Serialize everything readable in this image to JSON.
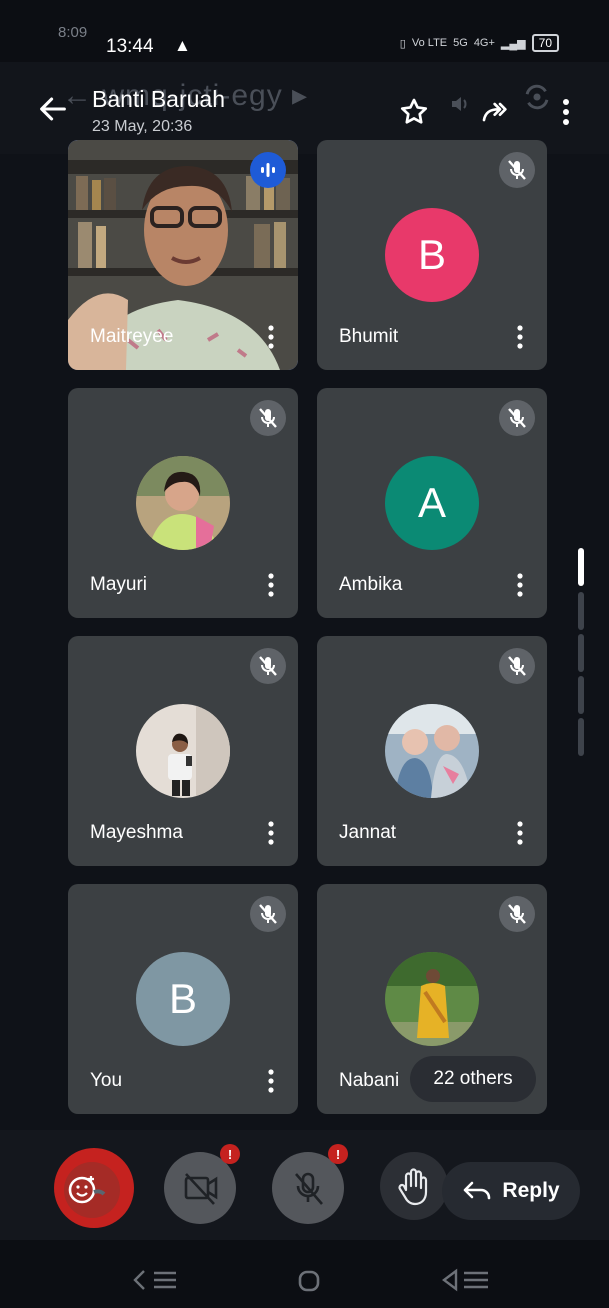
{
  "status_bar": {
    "ghost_time": "8:09",
    "time": "13:44",
    "network_1": "Vo LTE",
    "network_2": "5G",
    "network_3": "4G+",
    "battery": "70"
  },
  "header": {
    "title": "Banti Baruah",
    "subtitle": "23 May, 20:36",
    "ghost_title": "← wmq-jcti-egy ▸"
  },
  "participants": [
    {
      "name": "Maitreyee",
      "type": "video",
      "speaking": true
    },
    {
      "name": "Bhumit",
      "type": "initial",
      "initial": "B",
      "color": "#e8396a"
    },
    {
      "name": "Mayuri",
      "type": "photo"
    },
    {
      "name": "Ambika",
      "type": "initial",
      "initial": "A",
      "color": "#0b8a74"
    },
    {
      "name": "Mayeshma",
      "type": "photo"
    },
    {
      "name": "Jannat",
      "type": "photo"
    },
    {
      "name": "You",
      "type": "initial",
      "initial": "B",
      "color": "#7f97a3"
    },
    {
      "name": "Nabani",
      "type": "photo"
    }
  ],
  "others_chip": "22 others",
  "controls": {
    "camera_badge": "!",
    "mic_badge": "!",
    "reply_label": "Reply"
  },
  "colors": {
    "mute_bg": "#5f6368",
    "tile_bg": "#3c4043",
    "active_outline": "#5c7dd6",
    "end_call": "#c5221f"
  }
}
